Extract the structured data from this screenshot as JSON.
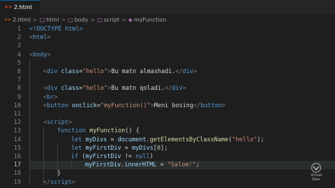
{
  "tab": {
    "label": "2.html",
    "icon": "html-file-icon"
  },
  "breadcrumb": {
    "items": [
      "2.html",
      "html",
      "body",
      "script",
      "myFunction"
    ],
    "separator": ">"
  },
  "active_line": 17,
  "line_numbers": [
    "1",
    "2",
    "3",
    "4",
    "5",
    "6",
    "7",
    "8",
    "9",
    "10",
    "11",
    "12",
    "13",
    "14",
    "15",
    "16",
    "17",
    "18",
    "19"
  ],
  "code": {
    "l1": [
      "<!DOCTYPE html>"
    ],
    "l2": [
      "<",
      "html",
      ">"
    ],
    "l4": [
      "<",
      "body",
      ">"
    ],
    "l6": [
      "<",
      "div",
      " ",
      "class",
      "=",
      "\"hello\"",
      ">",
      "Bu matn almashadi.",
      "</",
      "div",
      ">"
    ],
    "l8": [
      "<",
      "div",
      " ",
      "class",
      "=",
      "\"hello\"",
      ">",
      "Bu matn qoladi.",
      "</",
      "div",
      ">"
    ],
    "l9": [
      "<",
      "br",
      ">"
    ],
    "l10": [
      "<",
      "button",
      " ",
      "onclick",
      "=",
      "\"myFunction()\"",
      ">",
      "Meni bosing",
      "</",
      "button",
      ">"
    ],
    "l12": [
      "<",
      "script",
      ">"
    ],
    "l13": [
      "function",
      " ",
      "myFunction",
      "() {"
    ],
    "l14": [
      "let",
      " ",
      "myDivs",
      " = ",
      "document",
      ".",
      "getElementsByClassName",
      "(",
      "\"hello\"",
      ");"
    ],
    "l15": [
      "let",
      " ",
      "myFirstDiv",
      " = ",
      "myDivs",
      "[",
      "0",
      "];"
    ],
    "l16": [
      "if",
      " (",
      "myFirstDiv",
      " != ",
      "null",
      ")"
    ],
    "l17": [
      "myFirstDiv",
      ".",
      "innerHTML",
      " = ",
      "\"Salom!\"",
      ";"
    ],
    "l18": [
      "}"
    ],
    "l19": [
      "</",
      "script",
      ">"
    ]
  },
  "watermark": {
    "line1": "Virtual",
    "line2": "Dars"
  },
  "colors": {
    "background": "#1e1e1e",
    "tag": "#569cd6",
    "attribute": "#9cdcfe",
    "string": "#ce9178",
    "function": "#dcdcaa",
    "number": "#b5cea8"
  }
}
